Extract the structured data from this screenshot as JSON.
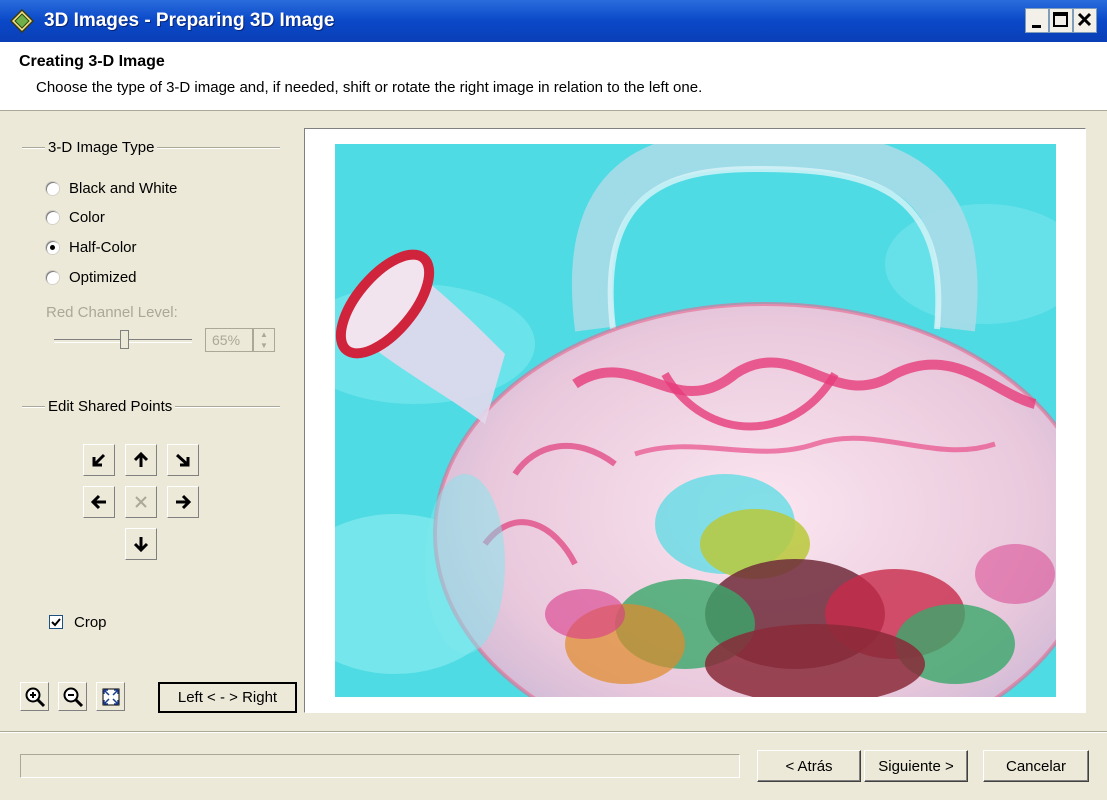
{
  "window": {
    "title": "3D Images - Preparing 3D Image"
  },
  "header": {
    "title": "Creating 3-D Image",
    "description": "Choose the type of 3-D image and, if needed, shift or rotate the right image in relation to the left one."
  },
  "image_type": {
    "label": "3-D Image Type",
    "options": [
      "Black and White",
      "Color",
      "Half-Color",
      "Optimized"
    ],
    "selected": "Half-Color"
  },
  "red_channel": {
    "label": "Red Channel Level:",
    "value": "65%",
    "level": 0.65
  },
  "shared_points": {
    "label": "Edit Shared Points"
  },
  "crop": {
    "label": "Crop",
    "checked": true
  },
  "swap_button": "Left < - > Right",
  "footer": {
    "back": "< Atrás",
    "next": "Siguiente >",
    "cancel": "Cancelar"
  }
}
